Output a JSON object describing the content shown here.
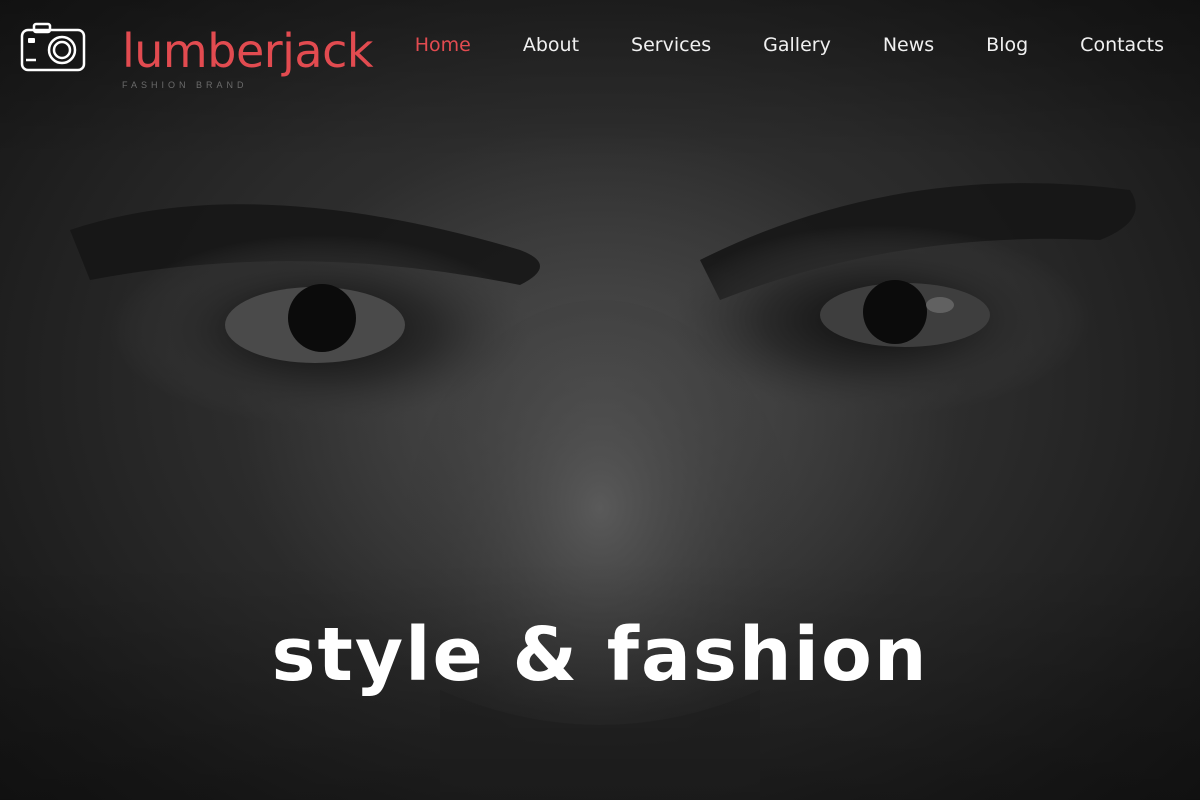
{
  "brand": {
    "name": "lumberjack",
    "tagline": "FASHION BRAND",
    "accent_color": "#e24b50",
    "logo_icon": "camera-icon"
  },
  "nav": {
    "items": [
      {
        "label": "Home",
        "active": true
      },
      {
        "label": "About",
        "active": false
      },
      {
        "label": "Services",
        "active": false
      },
      {
        "label": "Gallery",
        "active": false
      },
      {
        "label": "News",
        "active": false
      },
      {
        "label": "Blog",
        "active": false
      },
      {
        "label": "Contacts",
        "active": false
      }
    ]
  },
  "hero": {
    "headline": "style & fashion",
    "background": "dark grayscale close-up portrait"
  }
}
